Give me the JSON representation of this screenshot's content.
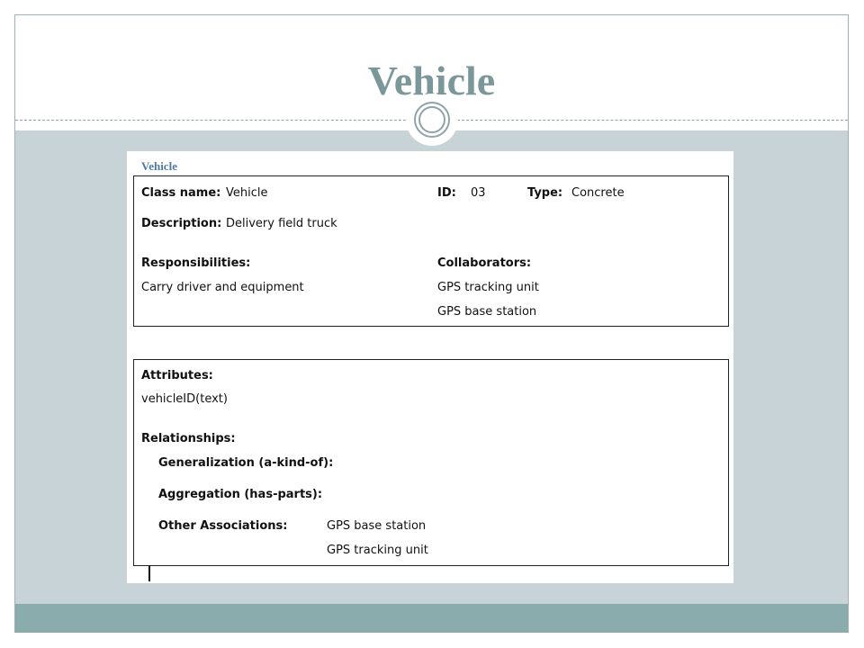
{
  "slide": {
    "title": "Vehicle"
  },
  "card": {
    "heading": "Vehicle",
    "class_name_label": "Class name:",
    "class_name_value": "Vehicle",
    "id_label": "ID:",
    "id_value": "03",
    "type_label": "Type:",
    "type_value": "Concrete",
    "description_label": "Description:",
    "description_value": "Delivery field truck",
    "responsibilities_label": "Responsibilities:",
    "responsibilities": [
      "Carry driver and equipment"
    ],
    "collaborators_label": "Collaborators:",
    "collaborators": [
      "GPS tracking unit",
      "GPS base station"
    ],
    "attributes_label": "Attributes:",
    "attributes": [
      "vehicleID(text)"
    ],
    "relationships_label": "Relationships:",
    "generalization_label": "Generalization (a-kind-of):",
    "aggregation_label": "Aggregation (has-parts):",
    "other_associations_label": "Other Associations:",
    "other_associations": [
      "GPS base station",
      "GPS tracking unit"
    ]
  },
  "colors": {
    "title": "#7c979a",
    "content_band": "#c8d3d7",
    "footer_band": "#8bacad",
    "card_heading": "#4f7aa5"
  }
}
